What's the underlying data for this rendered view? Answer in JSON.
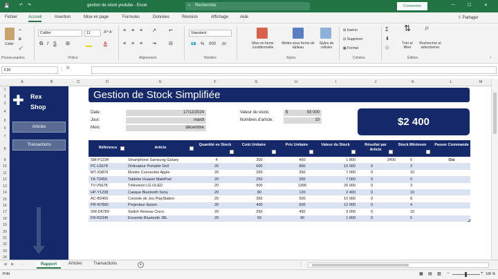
{
  "window": {
    "title": "gestion de stock youtube - Excel",
    "search_placeholder": "Rechercher",
    "signin": "Connexion"
  },
  "ribbon_tabs": [
    "Fichier",
    "Accueil",
    "Insertion",
    "Mise en page",
    "Formules",
    "Données",
    "Révision",
    "Affichage",
    "Aide"
  ],
  "share_label": "Partager",
  "ribbon": {
    "paste": "Coller",
    "clipboard": "Presse-papiers",
    "font_name": "Calibri",
    "font_group": "Police",
    "alignment_group": "Alignement",
    "number_format": "Standard",
    "number_group": "Nombre",
    "cond_format": "Mise en forme conditionnelle",
    "table_format": "Mettre sous forme de tableau",
    "cell_styles": "Styles de cellules",
    "styles_group": "Styles",
    "insert": "Insérer",
    "delete": "Supprimer",
    "format": "Format",
    "cells_group": "Cellules",
    "sort_filter": "Trier et filtrer",
    "find_select": "Rechercher et sélectionner",
    "editing_group": "Édition"
  },
  "formula_bar": {
    "name_box": "F20",
    "fx": "fx",
    "value": ""
  },
  "columns": [
    "A",
    "B",
    "C",
    "D",
    "E",
    "F",
    "G",
    "H",
    "I",
    "J",
    "K",
    "L",
    "M"
  ],
  "rows": [
    "1",
    "2",
    "3",
    "4",
    "5",
    "6",
    "7",
    "8",
    "9",
    "10",
    "11",
    "12",
    "13",
    "14",
    "15",
    "16",
    "17",
    "18",
    "19",
    "20",
    "21",
    "22",
    "23",
    "24",
    "25",
    "26"
  ],
  "sidebar": {
    "brand_line1": "Rex",
    "brand_line2": "Shop",
    "btn_articles": "Articles",
    "btn_transactions": "Transactions"
  },
  "banner_title": "Gestion de Stock Simplifiée",
  "info": {
    "date_label": "Date:",
    "date_value": "17/12/2024",
    "day_label": "Jour:",
    "day_value": "mardi",
    "month_label": "Mois:",
    "month_value": "décembre",
    "stock_value_label": "Valeur du stock:",
    "stock_currency": "$",
    "stock_value": "93 000",
    "article_count_label": "Nombres d'article:",
    "article_count": "10",
    "big_value": "$2 400"
  },
  "table": {
    "headers": [
      "Référence",
      "Article",
      "Quantité en Stock",
      "Coût Unitaire",
      "Prix Unitaire",
      "Valeur du Stock",
      "Résultat par Article",
      "Stock Minimum",
      "Passer Commande"
    ],
    "rows": [
      [
        "SM-P1234",
        "Smartphone Samsung Galaxy",
        "4",
        "300",
        "450",
        "1 800",
        "2400",
        "5",
        "Oui"
      ],
      [
        "PC-L5678",
        "Ordinateur Portable Dell",
        "20",
        "600",
        "800",
        "16 000",
        "0",
        "3",
        ""
      ],
      [
        "MT-X9876",
        "Montre Connectée Apple",
        "20",
        "250",
        "350",
        "7 000",
        "0",
        "10",
        ""
      ],
      [
        "TA-T3456",
        "Tablette Huawei MatePad",
        "20",
        "250",
        "350",
        "7 000",
        "0",
        "5",
        ""
      ],
      [
        "TV-V5678",
        "Télévision LG OLED",
        "20",
        "900",
        "1300",
        "26 000",
        "0",
        "3",
        ""
      ],
      [
        "HP-Y1238",
        "Casque Bluetooth Sony",
        "20",
        "80",
        "120",
        "2 400",
        "0",
        "10",
        ""
      ],
      [
        "AC-B3456",
        "Console de Jeu PlayStation",
        "20",
        "350",
        "500",
        "10 000",
        "0",
        "8",
        ""
      ],
      [
        "PR-N7890",
        "Projecteur Epson",
        "20",
        "400",
        "600",
        "12 000",
        "0",
        "4",
        ""
      ],
      [
        "SW-D6789",
        "Switch Réseau Cisco",
        "20",
        "250",
        "450",
        "9 000",
        "0",
        "10",
        ""
      ],
      [
        "FR-R2345",
        "Enceinte Bluetooth JBL",
        "20",
        "50",
        "90",
        "1 800",
        "0",
        "5",
        ""
      ]
    ]
  },
  "sheet_tabs": [
    "Rapport",
    "Articles",
    "Transactions"
  ],
  "status": {
    "left": "Prêt",
    "zoom": "100 %"
  },
  "colors": {
    "excel_green": "#217346",
    "navy": "#15296a",
    "band": "#dbe3f3"
  }
}
